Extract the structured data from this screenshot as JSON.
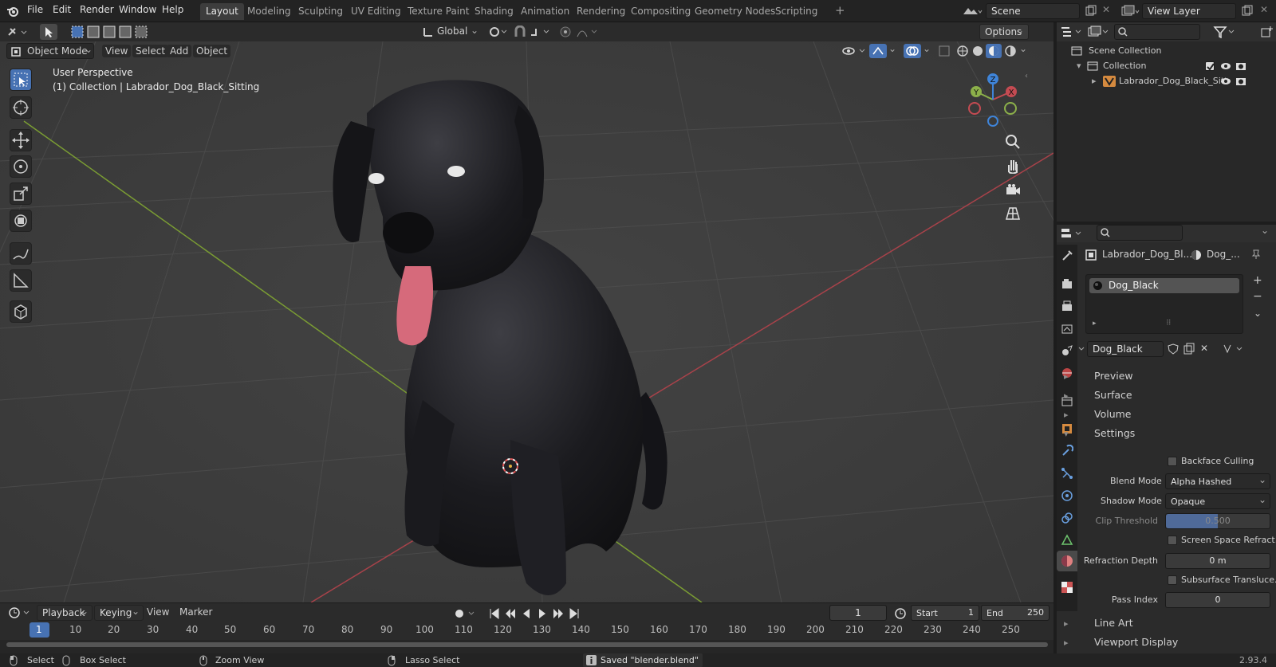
{
  "topbar": {
    "menus": [
      "File",
      "Edit",
      "Render",
      "Window",
      "Help"
    ],
    "workspaces": [
      "Layout",
      "Modeling",
      "Sculpting",
      "UV Editing",
      "Texture Paint",
      "Shading",
      "Animation",
      "Rendering",
      "Compositing",
      "Geometry Nodes",
      "Scripting"
    ],
    "active_workspace": "Layout",
    "scene_name": "Scene",
    "view_layer": "View Layer"
  },
  "viewport_header": {
    "transform_orientation": "Global",
    "options_label": "Options",
    "mode": "Object Mode",
    "menus": [
      "View",
      "Select",
      "Add",
      "Object"
    ]
  },
  "viewport": {
    "overlay_title": "User Perspective",
    "overlay_subtitle": "(1) Collection | Labrador_Dog_Black_Sitting",
    "gizmo_axes": {
      "x": "X",
      "y": "Y",
      "z": "Z"
    }
  },
  "outliner": {
    "root": "Scene Collection",
    "collection": "Collection",
    "object": "Labrador_Dog_Black_Sitt"
  },
  "properties": {
    "object_name": "Labrador_Dog_Bl...",
    "material_short": "Dog_...",
    "slot_name": "Dog_Black",
    "material_name": "Dog_Black",
    "sections": {
      "preview": "Preview",
      "surface": "Surface",
      "volume": "Volume",
      "settings": "Settings",
      "line_art": "Line Art",
      "viewport_display": "Viewport Display"
    },
    "backface_culling": "Backface Culling",
    "blend_mode_label": "Blend Mode",
    "blend_mode_value": "Alpha Hashed",
    "shadow_mode_label": "Shadow Mode",
    "shadow_mode_value": "Opaque",
    "clip_threshold_label": "Clip Threshold",
    "clip_threshold_value": "0.500",
    "screen_space_refraction": "Screen Space Refract...",
    "refraction_depth_label": "Refraction Depth",
    "refraction_depth_value": "0 m",
    "subsurface_translucency": "Subsurface Transluce...",
    "pass_index_label": "Pass Index",
    "pass_index_value": "0"
  },
  "timeline": {
    "menus": [
      "Playback",
      "Keying",
      "View",
      "Marker"
    ],
    "current_frame": "1",
    "start_label": "Start",
    "start_value": "1",
    "end_label": "End",
    "end_value": "250",
    "ticks": [
      "1",
      "10",
      "20",
      "30",
      "40",
      "50",
      "60",
      "70",
      "80",
      "90",
      "100",
      "110",
      "120",
      "130",
      "140",
      "150",
      "160",
      "170",
      "180",
      "190",
      "200",
      "210",
      "220",
      "230",
      "240",
      "250"
    ]
  },
  "statusbar": {
    "select": "Select",
    "box_select": "Box Select",
    "zoom_view": "Zoom View",
    "lasso_select": "Lasso Select",
    "message": "Saved \"blender.blend\"",
    "version": "2.93.4"
  },
  "colors": {
    "accent": "#4772b3",
    "x_axis": "#c44b52",
    "y_axis": "#8cb04a",
    "z_axis": "#3f84d8"
  }
}
